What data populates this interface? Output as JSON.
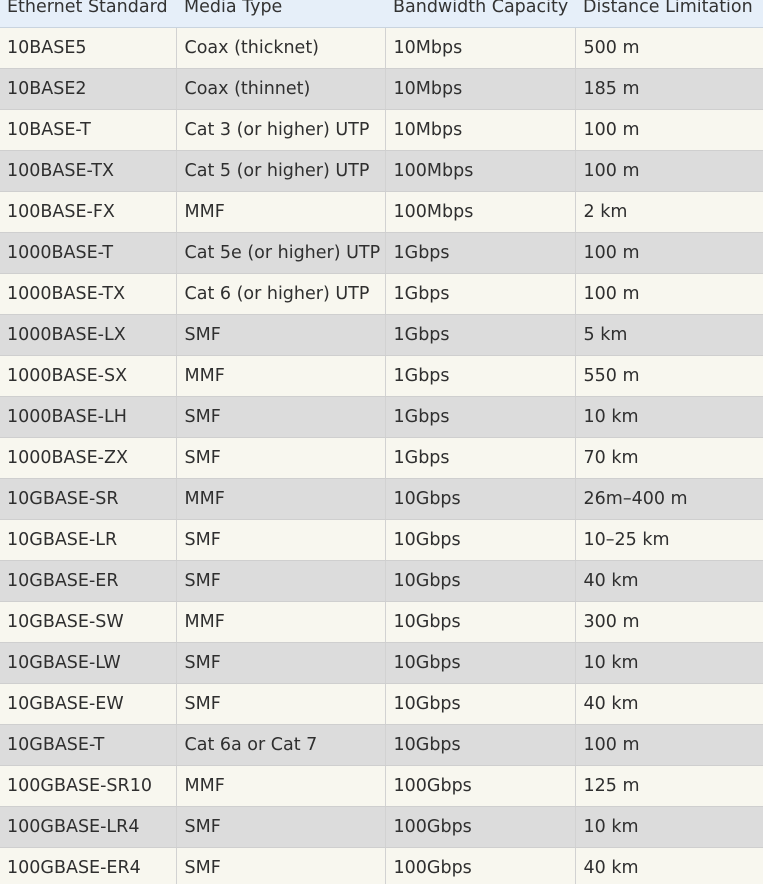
{
  "table": {
    "headers": [
      "Ethernet Standard",
      "Media Type",
      "Bandwidth Capacity",
      "Distance Limitation"
    ],
    "rows": [
      [
        "10BASE5",
        "Coax (thicknet)",
        "10Mbps",
        "500 m"
      ],
      [
        "10BASE2",
        "Coax (thinnet)",
        "10Mbps",
        "185 m"
      ],
      [
        "10BASE-T",
        "Cat 3 (or higher) UTP",
        "10Mbps",
        "100 m"
      ],
      [
        "100BASE-TX",
        "Cat 5 (or higher) UTP",
        "100Mbps",
        "100 m"
      ],
      [
        "100BASE-FX",
        "MMF",
        "100Mbps",
        "2 km"
      ],
      [
        "1000BASE-T",
        "Cat 5e (or higher) UTP",
        "1Gbps",
        "100 m"
      ],
      [
        "1000BASE-TX",
        "Cat 6 (or higher) UTP",
        "1Gbps",
        "100 m"
      ],
      [
        "1000BASE-LX",
        "SMF",
        "1Gbps",
        "5 km"
      ],
      [
        "1000BASE-SX",
        "MMF",
        "1Gbps",
        "550 m"
      ],
      [
        "1000BASE-LH",
        "SMF",
        "1Gbps",
        "10 km"
      ],
      [
        "1000BASE-ZX",
        "SMF",
        "1Gbps",
        "70 km"
      ],
      [
        "10GBASE-SR",
        "MMF",
        "10Gbps",
        "26m–400 m"
      ],
      [
        "10GBASE-LR",
        "SMF",
        "10Gbps",
        "10–25 km"
      ],
      [
        "10GBASE-ER",
        "SMF",
        "10Gbps",
        "40 km"
      ],
      [
        "10GBASE-SW",
        "MMF",
        "10Gbps",
        "300 m"
      ],
      [
        "10GBASE-LW",
        "SMF",
        "10Gbps",
        "10 km"
      ],
      [
        "10GBASE-EW",
        "SMF",
        "10Gbps",
        "40 km"
      ],
      [
        "10GBASE-T",
        "Cat 6a or Cat 7",
        "10Gbps",
        "100 m"
      ],
      [
        "100GBASE-SR10",
        "MMF",
        "100Gbps",
        "125 m"
      ],
      [
        "100GBASE-LR4",
        "SMF",
        "100Gbps",
        "10 km"
      ],
      [
        "100GBASE-ER4",
        "SMF",
        "100Gbps",
        "40 km"
      ]
    ]
  },
  "colors": {
    "header_bg": "#e6eff9",
    "row_odd_bg": "#f8f7ef",
    "row_even_bg": "#dcdcdc",
    "text": "#2f2f2f"
  }
}
